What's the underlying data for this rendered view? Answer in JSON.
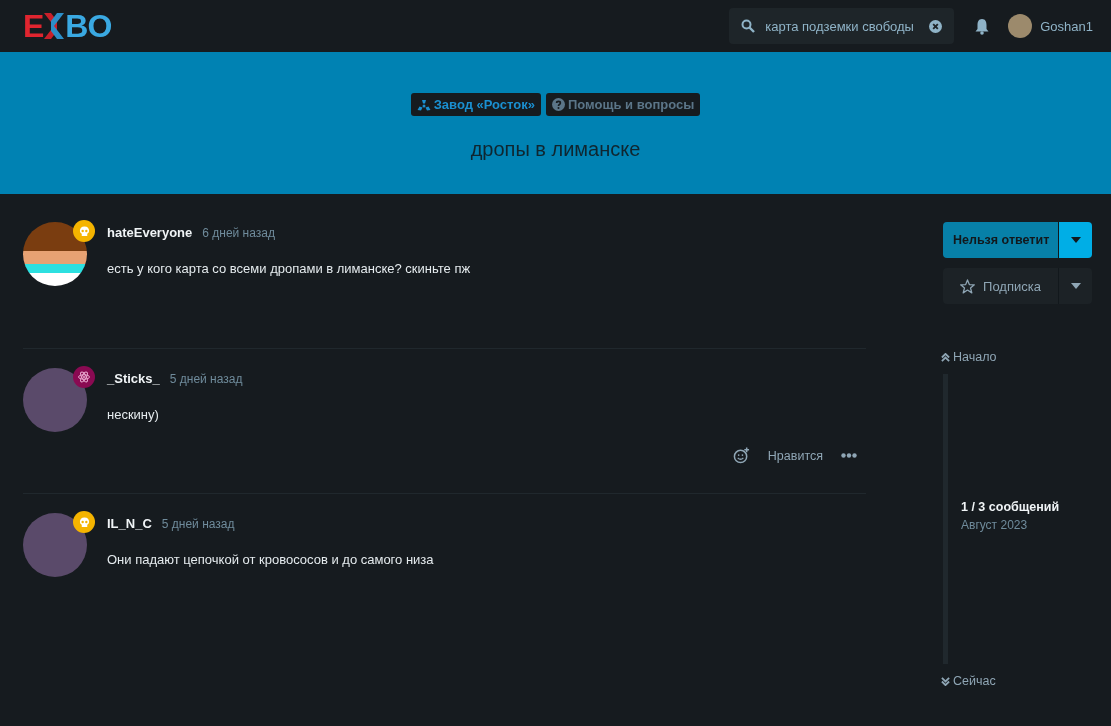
{
  "header": {
    "logo": {
      "left": "E",
      "right": "BO"
    },
    "search": {
      "value": "карта подземки свободы"
    },
    "user": {
      "name": "Goshan1"
    }
  },
  "hero": {
    "tags": [
      {
        "kind": "radiation",
        "label": "Завод «Росток»"
      },
      {
        "kind": "question",
        "label": "Помощь и вопросы"
      }
    ],
    "title": "дропы в лиманске"
  },
  "posts": [
    {
      "author": "hateEveryone",
      "time": "6 дней назад",
      "text": "есть у кого карта со всеми дропами в лиманске? скиньте пж",
      "badge": {
        "kind": "skull",
        "color": "#f5b400"
      },
      "avatar": {
        "kind": "pixel"
      }
    },
    {
      "author": "_Sticks_",
      "time": "5 дней назад",
      "text": "нескину)",
      "badge": {
        "kind": "atom",
        "color": "#8a0a52"
      },
      "avatar": {
        "kind": "photo"
      },
      "actions": {
        "like": "Нравится"
      }
    },
    {
      "author": "IL_N_C",
      "time": "5 дней назад",
      "text": "Они падают цепочкой от кровососов и до самого низа",
      "badge": {
        "kind": "skull",
        "color": "#f5b400"
      },
      "avatar": {
        "kind": "photo"
      }
    }
  ],
  "sidebar": {
    "reply_button": "Нельзя ответит",
    "subscribe_button": "Подписка",
    "timeline": {
      "start": "Начало",
      "position": "1 / 3 сообщений",
      "date": "Август 2023",
      "end": "Сейчас"
    }
  }
}
